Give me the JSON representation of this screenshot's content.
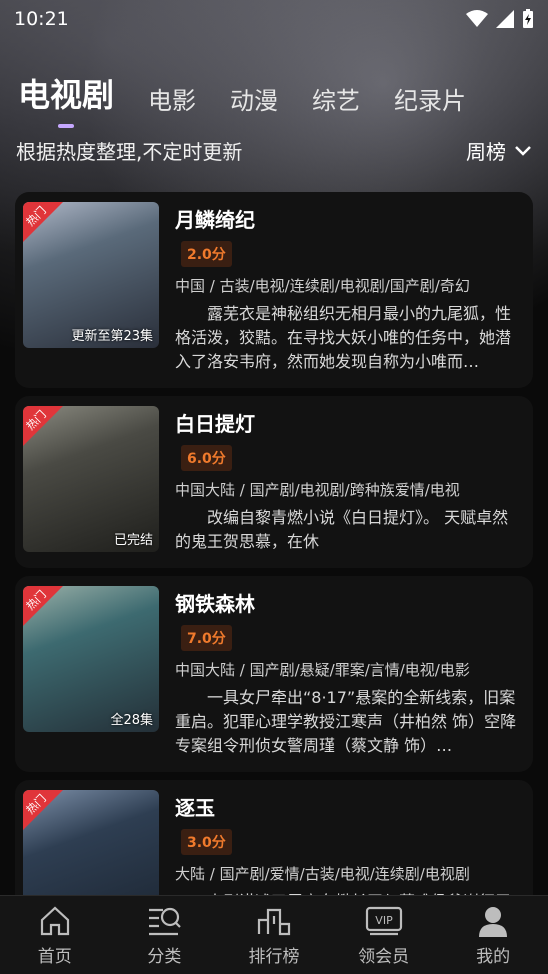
{
  "status": {
    "time": "10:21"
  },
  "tabs": [
    "电视剧",
    "电影",
    "动漫",
    "综艺",
    "纪录片"
  ],
  "subtitle": "根据热度整理,不定时更新",
  "rank_select": "周榜",
  "items": [
    {
      "title": "月鳞绮纪",
      "score": "2.0分",
      "tags": "中国 / 古装/电视/连续剧/电视剧/国产剧/奇幻",
      "desc": "露芜衣是神秘组织无相月最小的九尾狐，性格活泼，狡黠。在寻找大妖小唯的任务中，她潜入了洛安韦府，然而她发现自称为小唯而…",
      "ep": "更新至第23集",
      "hot": "热门",
      "poster_colors": [
        "#5a6a7a",
        "#2a2f3a",
        "#b0b8c8"
      ]
    },
    {
      "title": "白日提灯",
      "score": "6.0分",
      "tags": "中国大陆 / 国产剧/电视剧/跨种族爱情/电视",
      "desc": "改编自黎青燃小说《白日提灯》。 天赋卓然的鬼王贺思慕，在休",
      "ep": "已完结",
      "hot": "热门",
      "poster_colors": [
        "#4a4a44",
        "#1f1f1c",
        "#8a8a80"
      ]
    },
    {
      "title": "钢铁森林",
      "score": "7.0分",
      "tags": "中国大陆 / 国产剧/悬疑/罪案/言情/电视/电影",
      "desc": "一具女尸牵出“8·17”悬案的全新线索，旧案重启。犯罪心理学教授江寒声（井柏然 饰）空降专案组令刑侦女警周瑾（蔡文静 饰）…",
      "ep": "全28集",
      "hot": "热门",
      "poster_colors": [
        "#3d6a70",
        "#243038",
        "#9ab0a8"
      ]
    },
    {
      "title": "逐玉",
      "score": "3.0分",
      "tags": "大陆 / 国产剧/爱情/古装/电视/连续剧/电视剧",
      "desc": "本剧讲述了屠户女樊长玉与落难侯爷谢征于",
      "ep": "",
      "hot": "热门",
      "poster_colors": [
        "#2e3e52",
        "#1b2430",
        "#7c8fa8"
      ]
    }
  ],
  "nav": [
    "首页",
    "分类",
    "排行榜",
    "领会员",
    "我的"
  ]
}
